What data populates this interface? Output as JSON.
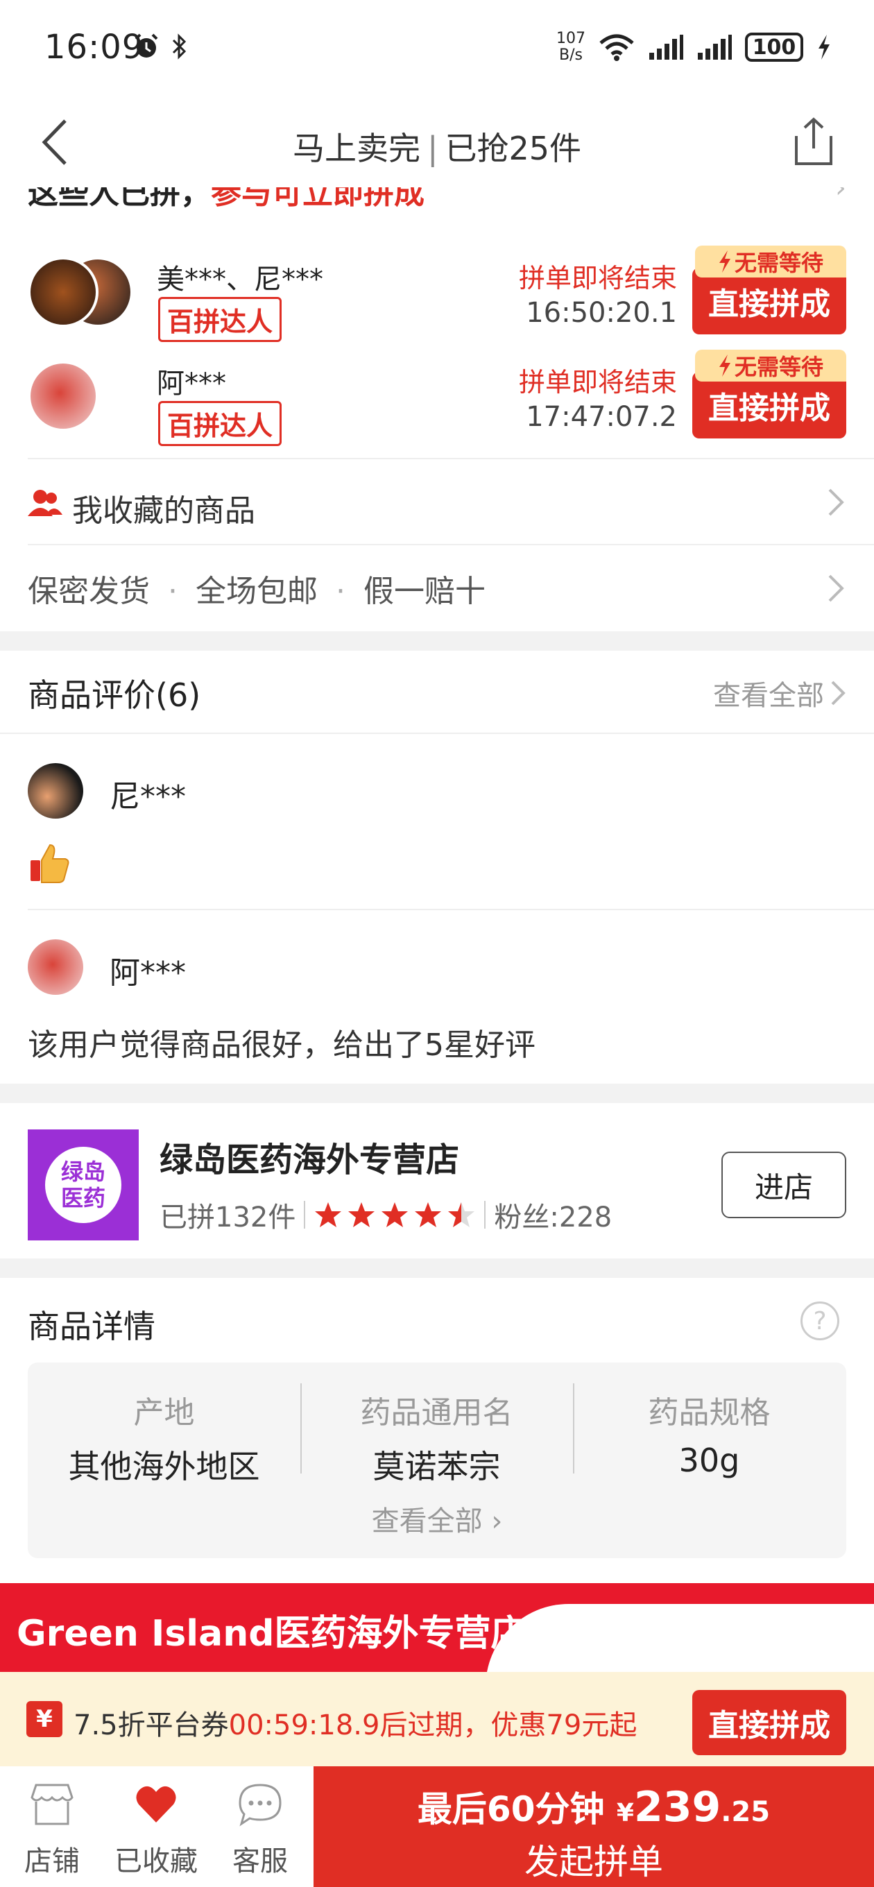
{
  "status_bar": {
    "time": "16:09",
    "net_speed_value": "107",
    "net_speed_unit": "B/s",
    "battery": "100"
  },
  "nav": {
    "title_left": "马上卖完",
    "title_right": "已抢25件"
  },
  "group_banner": {
    "text_black": "这些人已拼，",
    "text_red": "参与可立即拼成"
  },
  "groups": [
    {
      "names": "美***、尼***",
      "badge": "百拼达人",
      "ending": "拼单即将结束",
      "timer": "16:50:20.1",
      "tag": "无需等待",
      "button": "直接拼成"
    },
    {
      "names": "阿***",
      "badge": "百拼达人",
      "ending": "拼单即将结束",
      "timer": "17:47:07.2",
      "tag": "无需等待",
      "button": "直接拼成"
    }
  ],
  "favorites_link": "我收藏的商品",
  "services": [
    "保密发货",
    "全场包邮",
    "假一赔十"
  ],
  "reviews": {
    "title": "商品评价(6)",
    "see_all": "查看全部",
    "items": [
      {
        "name": "尼***",
        "text": ""
      },
      {
        "name": "阿***",
        "text": "该用户觉得商品很好，给出了5星好评"
      }
    ]
  },
  "store": {
    "logo_line1": "绿岛",
    "logo_line2": "医药",
    "name": "绿岛医药海外专营店",
    "sold": "已拼132件",
    "rating": 4.5,
    "fans": "粉丝:228",
    "enter_button": "进店"
  },
  "details": {
    "title": "商品详情",
    "help": "?",
    "columns": [
      {
        "key": "产地",
        "value": "其他海外地区"
      },
      {
        "key": "药品通用名",
        "value": "莫诺苯宗"
      },
      {
        "key": "药品规格",
        "value": "30g"
      }
    ],
    "see_all": "查看全部"
  },
  "promo_banner": "Green Island医药海外专营店",
  "coupon": {
    "icon": "¥",
    "text_prefix": "7.5折平台券",
    "text_red": "00:59:18.9后过期，优惠79元起",
    "button": "直接拼成"
  },
  "bottom": {
    "tabs": [
      {
        "label": "店铺",
        "icon": "store-icon"
      },
      {
        "label": "已收藏",
        "icon": "heart-icon"
      },
      {
        "label": "客服",
        "icon": "chat-icon"
      }
    ],
    "cta_prefix": "最后60分钟",
    "cta_currency": "¥",
    "cta_price_int": "239",
    "cta_price_dec": ".25",
    "cta_label": "发起拼单"
  },
  "colors": {
    "accent": "#e02e24",
    "store_purple": "#9b2fd6",
    "coupon_bg": "#fdf3d8",
    "star": "#e02e24"
  }
}
